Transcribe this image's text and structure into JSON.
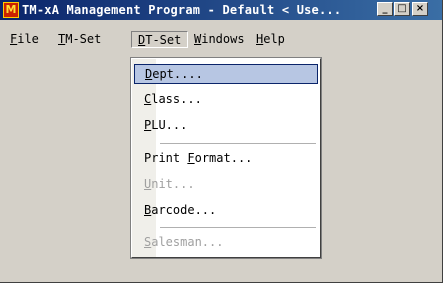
{
  "window": {
    "title": "TM-xA Management Program - Default < Use...",
    "minimize_glyph": "_",
    "maximize_glyph": "□",
    "close_glyph": "×"
  },
  "menubar": {
    "items": [
      {
        "label": "File",
        "accel": "F"
      },
      {
        "label": "TM-Set",
        "accel": "T"
      },
      {
        "label": "DT-Set",
        "accel": "D"
      },
      {
        "label": "Windows",
        "accel": "W"
      },
      {
        "label": "Help",
        "accel": "H"
      }
    ]
  },
  "dropdown": {
    "items": [
      {
        "text": "Dept....",
        "state": "highlighted"
      },
      {
        "text": "Class...",
        "state": "normal"
      },
      {
        "text": "PLU...",
        "state": "normal"
      },
      {
        "text": "Print Format...",
        "state": "normal"
      },
      {
        "text": "Unit...",
        "state": "disabled"
      },
      {
        "text": "Barcode...",
        "state": "normal"
      },
      {
        "text": "Salesman...",
        "state": "disabled"
      }
    ]
  },
  "colors": {
    "title_bar": "#0a246a",
    "highlight": "#b7c6e3",
    "face": "#d4d0c8"
  }
}
